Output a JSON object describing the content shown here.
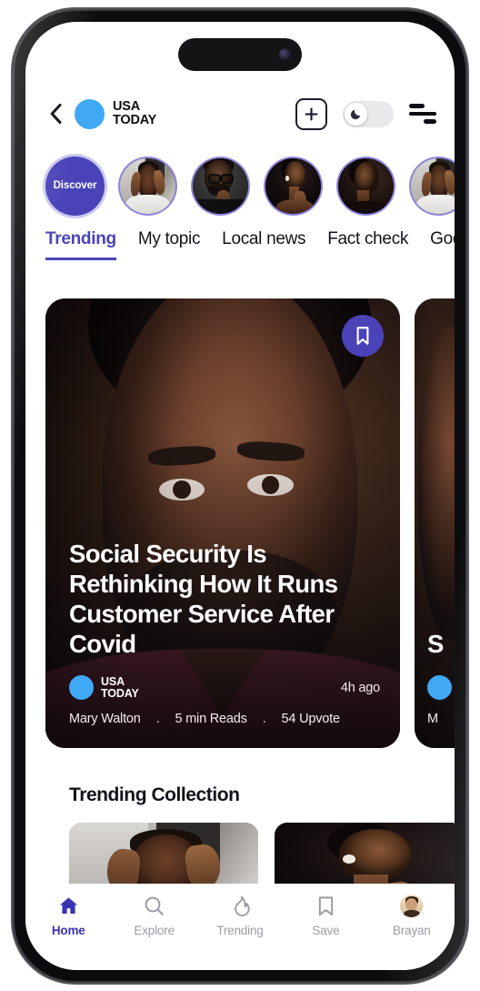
{
  "header": {
    "back_icon": "chevron-left-icon",
    "brand_name": "USA\nTODAY",
    "add_icon": "plus-icon",
    "dark_mode_icon": "moon-icon",
    "menu_icon": "hamburger-menu-icon",
    "accent_color": "#4a43b8",
    "brand_color": "#3FA9F5"
  },
  "stories": {
    "discover_label": "Discover",
    "items": [
      {
        "name": "story-discover",
        "type": "discover"
      },
      {
        "name": "story-avatar-1",
        "type": "headache"
      },
      {
        "name": "story-avatar-2",
        "type": "glasses"
      },
      {
        "name": "story-avatar-3",
        "type": "woman"
      },
      {
        "name": "story-avatar-4",
        "type": "profile"
      },
      {
        "name": "story-avatar-5",
        "type": "headache"
      }
    ]
  },
  "tabs": [
    {
      "label": "Trending",
      "active": true
    },
    {
      "label": "My topic",
      "active": false
    },
    {
      "label": "Local news",
      "active": false
    },
    {
      "label": "Fact check",
      "active": false
    },
    {
      "label": "Good news",
      "active": false
    }
  ],
  "hero": {
    "bookmark_icon": "bookmark-icon",
    "headline": "Social Security Is Rethinking How It Runs Customer Service After Covid",
    "source": "USA\nTODAY",
    "time_ago": "4h ago",
    "author": "Mary Walton",
    "read_time": "5 min Reads",
    "upvotes": "54 Upvote",
    "separator": "."
  },
  "hero_next": {
    "headline": "S",
    "source": "M"
  },
  "collection": {
    "title": "Trending Collection",
    "cards": [
      {
        "name": "collection-card-1",
        "type": "headache"
      },
      {
        "name": "collection-card-2",
        "type": "woman"
      }
    ]
  },
  "bottom_nav": [
    {
      "label": "Home",
      "icon": "home-icon",
      "active": true
    },
    {
      "label": "Explore",
      "icon": "search-icon",
      "active": false
    },
    {
      "label": "Trending",
      "icon": "flame-icon",
      "active": false
    },
    {
      "label": "Save",
      "icon": "bookmark-icon",
      "active": false
    },
    {
      "label": "Brayan",
      "icon": "avatar-icon",
      "active": true
    }
  ]
}
